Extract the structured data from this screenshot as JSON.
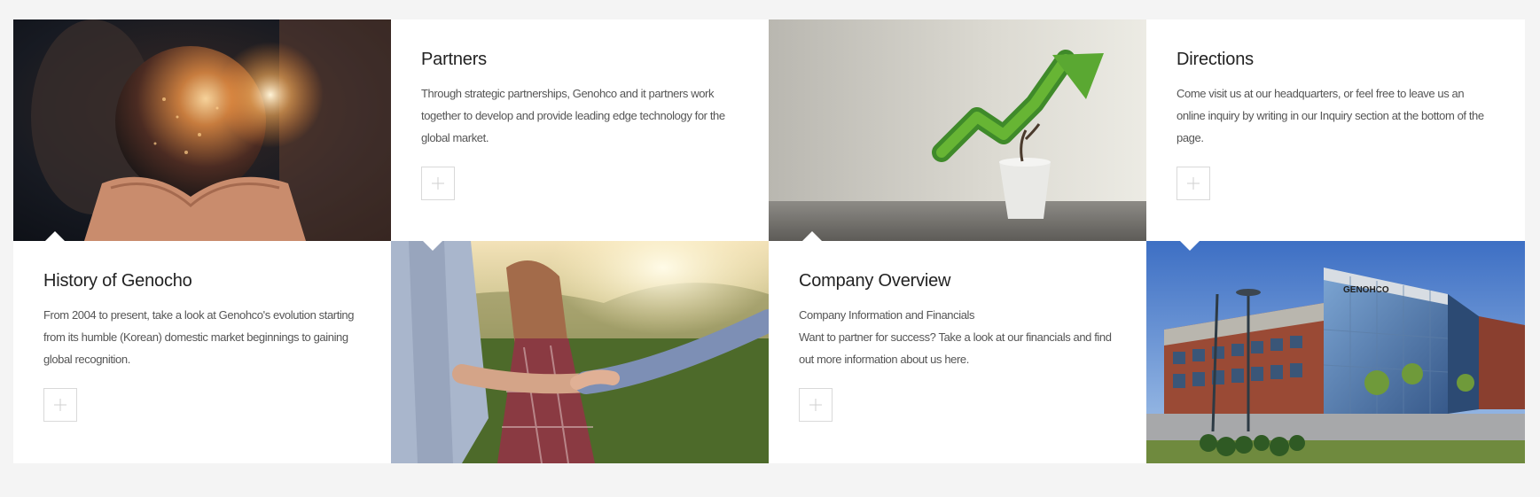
{
  "cards": {
    "partners": {
      "title": "Partners",
      "text": "Through strategic partnerships, Genohco and it partners work together to develop and provide leading edge technology for the global market."
    },
    "directions": {
      "title": "Directions",
      "text": "Come visit us at our headquarters, or feel free to leave us an online inquiry by writing in our Inquiry section at the bottom of the page."
    },
    "history": {
      "title": "History of Genocho",
      "text": "From 2004 to present, take a look at Genohco's evolution starting from its humble (Korean) domestic market beginnings to gaining global recognition."
    },
    "overview": {
      "title": "Company Overview",
      "subtitle": "Company Information and Financials",
      "text": "Want to partner for success? Take a look at our financials and find out more information about us here."
    }
  },
  "building_sign": "GENOHCO",
  "colors": {
    "page_bg": "#f4f4f4",
    "card_bg": "#ffffff",
    "title": "#222222",
    "body": "#555555"
  },
  "icons": {
    "more": "plus-icon"
  }
}
